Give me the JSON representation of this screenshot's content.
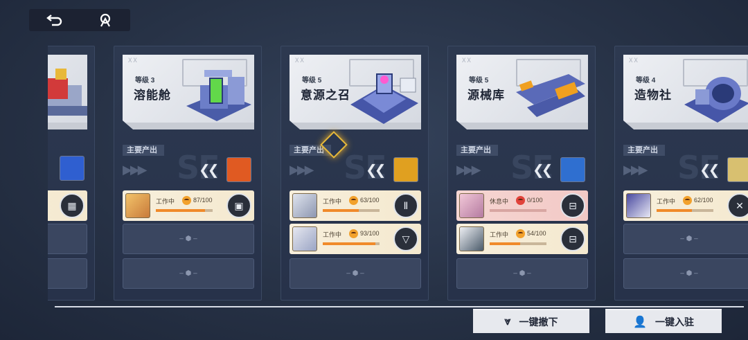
{
  "topbar": {
    "back_icon": "back-arrow-icon",
    "home_icon": "home-emblem-icon"
  },
  "cards": [
    {
      "id": "partial-left",
      "level": "",
      "name": "",
      "output_label": "",
      "output_icon": "document-icon",
      "output_color": "#2f5fd0",
      "slots": [
        {
          "type": "partial"
        },
        {
          "type": "empty"
        },
        {
          "type": "empty"
        }
      ]
    },
    {
      "id": "rongneng",
      "level": "等级 3",
      "name": "溶能舱",
      "output_label": "主要产出",
      "output_icon": "battery-icon",
      "output_color": "#e05a22",
      "slots": [
        {
          "type": "filled",
          "status": "工作中",
          "stamina": "87/100",
          "progress": 0.87,
          "mood": "ok",
          "role_icon": "cube-icon"
        },
        {
          "type": "empty",
          "plus": "– ⬢ –"
        },
        {
          "type": "empty",
          "plus": "– ⬢ –"
        }
      ]
    },
    {
      "id": "yiyuan",
      "level": "等级 5",
      "name": "意源之召",
      "output_label": "主要产出",
      "output_icon": "scroll-icon",
      "output_color": "#e0a020",
      "slots": [
        {
          "type": "filled",
          "status": "工作中",
          "stamina": "63/100",
          "progress": 0.63,
          "mood": "ok",
          "role_icon": "tower-icon"
        },
        {
          "type": "filled",
          "status": "工作中",
          "stamina": "93/100",
          "progress": 0.93,
          "mood": "ok",
          "role_icon": "triangle-emblem-icon"
        },
        {
          "type": "empty",
          "plus": "– ⬢ –"
        }
      ]
    },
    {
      "id": "yuanxie",
      "level": "等级 5",
      "name": "源械库",
      "output_label": "主要产出",
      "output_icon": "orb-icon",
      "output_color": "#2f6fd0",
      "slots": [
        {
          "type": "rest",
          "status": "休息中",
          "stamina": "0/100",
          "progress": 0.0,
          "mood": "bad",
          "role_icon": "machine-icon"
        },
        {
          "type": "filled",
          "status": "工作中",
          "stamina": "54/100",
          "progress": 0.54,
          "mood": "ok",
          "role_icon": "machine-icon"
        },
        {
          "type": "empty",
          "plus": "– ⬢ –"
        }
      ]
    },
    {
      "id": "zaowu",
      "level": "等级 4",
      "name": "造物社",
      "output_label": "主要产出",
      "output_icon": "crate-icon",
      "output_color": "#d8c070",
      "slots": [
        {
          "type": "filled",
          "status": "工作中",
          "stamina": "62/100",
          "progress": 0.62,
          "mood": "ok",
          "role_icon": "wrench-icon"
        },
        {
          "type": "empty",
          "plus": "– ⬢ –"
        },
        {
          "type": "empty",
          "plus": "– ⬢ –"
        }
      ]
    }
  ],
  "actions": {
    "withdraw_all": "一键撤下",
    "station_all": "一键入驻"
  }
}
